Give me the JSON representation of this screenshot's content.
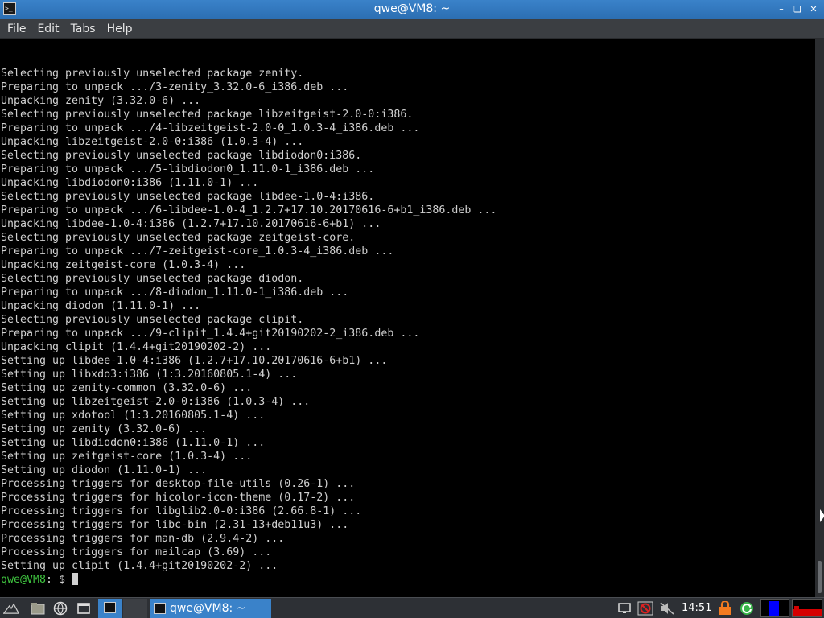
{
  "window": {
    "title": "qwe@VM8: ~",
    "minimize_icon": "minimize-icon",
    "maximize_icon": "maximize-icon",
    "close_icon": "close-icon"
  },
  "menubar": {
    "items": [
      "File",
      "Edit",
      "Tabs",
      "Help"
    ]
  },
  "terminal": {
    "lines": [
      "Selecting previously unselected package zenity.",
      "Preparing to unpack .../3-zenity_3.32.0-6_i386.deb ...",
      "Unpacking zenity (3.32.0-6) ...",
      "Selecting previously unselected package libzeitgeist-2.0-0:i386.",
      "Preparing to unpack .../4-libzeitgeist-2.0-0_1.0.3-4_i386.deb ...",
      "Unpacking libzeitgeist-2.0-0:i386 (1.0.3-4) ...",
      "Selecting previously unselected package libdiodon0:i386.",
      "Preparing to unpack .../5-libdiodon0_1.11.0-1_i386.deb ...",
      "Unpacking libdiodon0:i386 (1.11.0-1) ...",
      "Selecting previously unselected package libdee-1.0-4:i386.",
      "Preparing to unpack .../6-libdee-1.0-4_1.2.7+17.10.20170616-6+b1_i386.deb ...",
      "Unpacking libdee-1.0-4:i386 (1.2.7+17.10.20170616-6+b1) ...",
      "Selecting previously unselected package zeitgeist-core.",
      "Preparing to unpack .../7-zeitgeist-core_1.0.3-4_i386.deb ...",
      "Unpacking zeitgeist-core (1.0.3-4) ...",
      "Selecting previously unselected package diodon.",
      "Preparing to unpack .../8-diodon_1.11.0-1_i386.deb ...",
      "Unpacking diodon (1.11.0-1) ...",
      "Selecting previously unselected package clipit.",
      "Preparing to unpack .../9-clipit_1.4.4+git20190202-2_i386.deb ...",
      "Unpacking clipit (1.4.4+git20190202-2) ...",
      "Setting up libdee-1.0-4:i386 (1.2.7+17.10.20170616-6+b1) ...",
      "Setting up libxdo3:i386 (1:3.20160805.1-4) ...",
      "Setting up zenity-common (3.32.0-6) ...",
      "Setting up libzeitgeist-2.0-0:i386 (1.0.3-4) ...",
      "Setting up xdotool (1:3.20160805.1-4) ...",
      "Setting up zenity (3.32.0-6) ...",
      "Setting up libdiodon0:i386 (1.11.0-1) ...",
      "Setting up zeitgeist-core (1.0.3-4) ...",
      "Setting up diodon (1.11.0-1) ...",
      "Processing triggers for desktop-file-utils (0.26-1) ...",
      "Processing triggers for hicolor-icon-theme (0.17-2) ...",
      "Processing triggers for libglib2.0-0:i386 (2.66.8-1) ...",
      "Processing triggers for libc-bin (2.31-13+deb11u3) ...",
      "Processing triggers for man-db (2.9.4-2) ...",
      "Processing triggers for mailcap (3.69) ...",
      "Setting up clipit (1.4.4+git20190202-2) ..."
    ],
    "prompt_user": "qwe@VM8",
    "prompt_rest": ": $ "
  },
  "taskbar": {
    "task_label": "qwe@VM8: ~",
    "clock": "14:51",
    "colors": {
      "task_active": "#3a82c9",
      "prompt_green": "#3fc43f"
    }
  }
}
